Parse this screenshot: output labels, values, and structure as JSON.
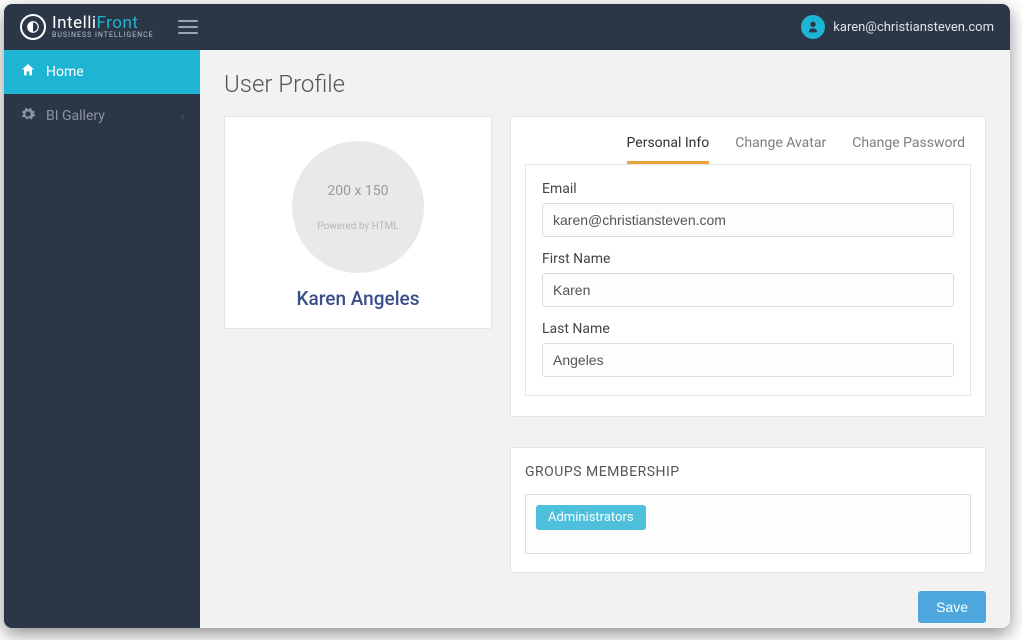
{
  "header": {
    "logo_main_a": "Intelli",
    "logo_main_b": "Front",
    "logo_sub": "BUSINESS INTELLIGENCE",
    "user_email": "karen@christiansteven.com"
  },
  "sidebar": {
    "items": [
      {
        "label": "Home",
        "active": true
      },
      {
        "label": "BI Gallery",
        "active": false
      }
    ]
  },
  "page": {
    "title": "User Profile"
  },
  "profile": {
    "avatar_placeholder": "200 x 150",
    "avatar_subtext": "Powered by HTML",
    "display_name": "Karen Angeles"
  },
  "tabs": [
    {
      "label": "Personal Info",
      "active": true
    },
    {
      "label": "Change Avatar",
      "active": false
    },
    {
      "label": "Change Password",
      "active": false
    }
  ],
  "form": {
    "email_label": "Email",
    "email_value": "karen@christiansteven.com",
    "first_name_label": "First Name",
    "first_name_value": "Karen",
    "last_name_label": "Last Name",
    "last_name_value": "Angeles"
  },
  "groups": {
    "title": "GROUPS MEMBERSHIP",
    "items": [
      "Administrators"
    ]
  },
  "actions": {
    "save_label": "Save"
  }
}
